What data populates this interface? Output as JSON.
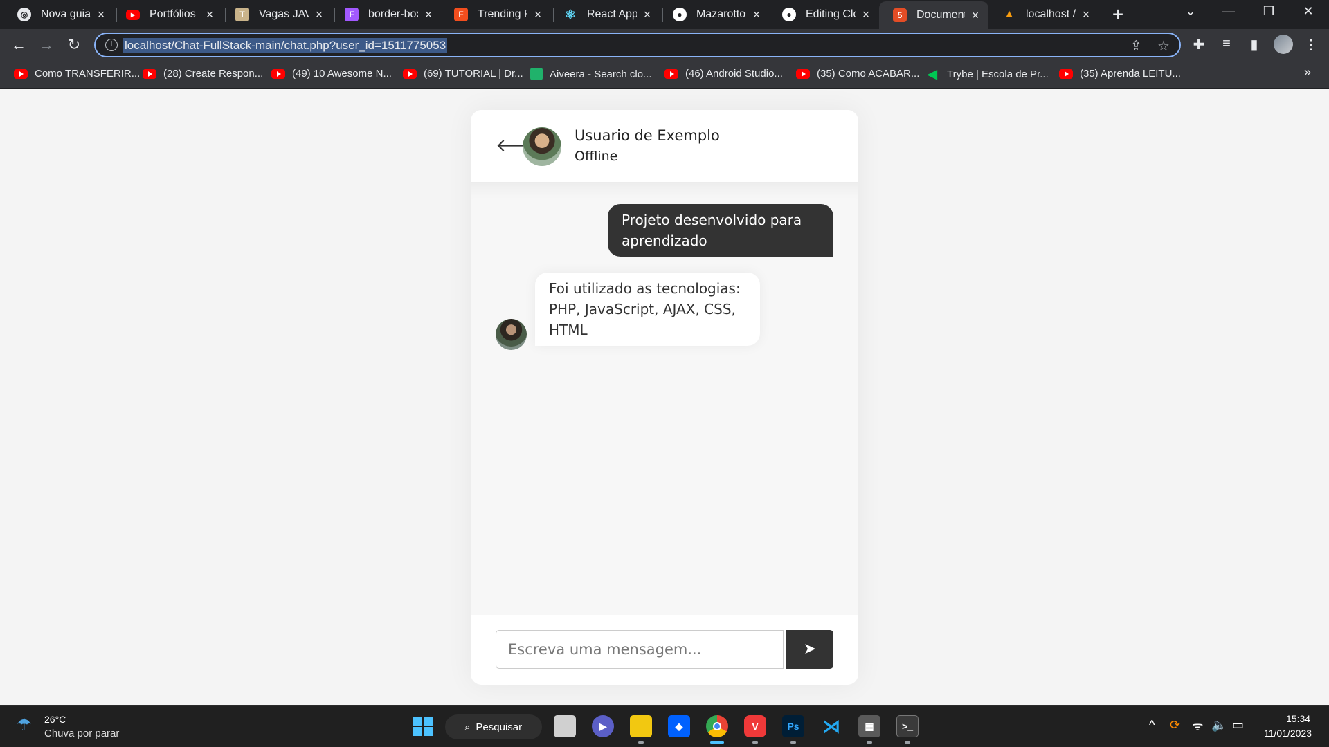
{
  "browser": {
    "tabs": [
      {
        "title": "Nova guia",
        "icon": "chrome-icon",
        "color": "#e8eaed"
      },
      {
        "title": "Portfólios c",
        "icon": "youtube-icon",
        "color": "#ff0000"
      },
      {
        "title": "Vagas JAVA",
        "icon": "hammer-icon",
        "color": "#c9b38a"
      },
      {
        "title": "border-box",
        "icon": "figma-icon",
        "color": "#a259ff"
      },
      {
        "title": "Trending Re",
        "icon": "figma-icon",
        "color": "#f24e1e"
      },
      {
        "title": "React App",
        "icon": "react-icon",
        "color": "#61dafb"
      },
      {
        "title": "MazarottoC",
        "icon": "github-icon",
        "color": "#ffffff"
      },
      {
        "title": "Editing Clor",
        "icon": "github-icon",
        "color": "#ffffff"
      },
      {
        "title": "Document",
        "icon": "html5-icon",
        "color": "#e44d26",
        "active": true
      },
      {
        "title": "localhost /",
        "icon": "phpmyadmin-icon",
        "color": "#f89c0e"
      }
    ],
    "url": "localhost/Chat-FullStack-main/chat.php?user_id=1511775053",
    "bookmarks": [
      {
        "label": "Como TRANSFERIR...",
        "icon": "youtube-icon"
      },
      {
        "label": "(28) Create Respon...",
        "icon": "youtube-icon"
      },
      {
        "label": "(49) 10 Awesome N...",
        "icon": "youtube-icon"
      },
      {
        "label": "(69) TUTORIAL | Dr...",
        "icon": "youtube-icon"
      },
      {
        "label": "Aiveera - Search clo...",
        "icon": "aiveera-icon"
      },
      {
        "label": "(46) Android Studio...",
        "icon": "youtube-icon"
      },
      {
        "label": "(35) Como ACABAR...",
        "icon": "youtube-icon"
      },
      {
        "label": "Trybe | Escola de Pr...",
        "icon": "trybe-icon"
      },
      {
        "label": "(35) Aprenda LEITU...",
        "icon": "youtube-icon"
      }
    ]
  },
  "chat": {
    "user_name": "Usuario de Exemplo",
    "status": "Offline",
    "messages": [
      {
        "direction": "outgoing",
        "text": "Projeto desenvolvido para aprendizado"
      },
      {
        "direction": "incoming",
        "text": "Foi utilizado as tecnologias: PHP, JavaScript, AJAX, CSS, HTML"
      }
    ],
    "input_placeholder": "Escreva uma mensagem..."
  },
  "taskbar": {
    "weather_temp": "26°C",
    "weather_desc": "Chuva por parar",
    "search_label": "Pesquisar",
    "time": "15:34",
    "date": "11/01/2023"
  }
}
